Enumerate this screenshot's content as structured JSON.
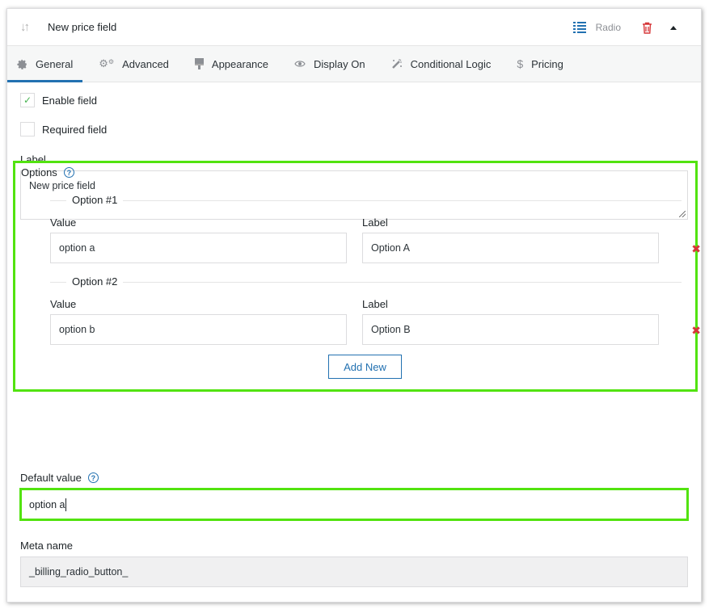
{
  "header": {
    "title": "New price field",
    "field_type": "Radio",
    "icons": {
      "sort": "sort-arrows-icon",
      "type": "list-icon",
      "delete": "trash-icon",
      "collapse": "caret-up-icon"
    }
  },
  "tabs": [
    {
      "label": "General",
      "icon": "gear-icon",
      "active": true
    },
    {
      "label": "Advanced",
      "icon": "gears-icon",
      "active": false
    },
    {
      "label": "Appearance",
      "icon": "paint-brush-icon",
      "active": false
    },
    {
      "label": "Display On",
      "icon": "eye-icon",
      "active": false
    },
    {
      "label": "Conditional Logic",
      "icon": "magic-wand-icon",
      "active": false
    },
    {
      "label": "Pricing",
      "icon": "dollar-icon",
      "active": false
    }
  ],
  "general": {
    "enable_field": {
      "label": "Enable field",
      "checked": true,
      "check_glyph": "✓"
    },
    "required_field": {
      "label": "Required field",
      "checked": false
    },
    "label_field": {
      "label": "Label",
      "value": "New price field"
    },
    "options": {
      "title": "Options",
      "help_glyph": "?",
      "items": [
        {
          "legend": "Option #1",
          "value_label": "Value",
          "value": "option a",
          "label_label": "Label",
          "label": "Option A"
        },
        {
          "legend": "Option #2",
          "value_label": "Value",
          "value": "option b",
          "label_label": "Label",
          "label": "Option B"
        }
      ],
      "remove_glyph": "✖",
      "add_new_label": "Add New"
    },
    "default_value": {
      "label": "Default value",
      "help_glyph": "?",
      "value": "option a"
    },
    "meta_name": {
      "label": "Meta name",
      "value": "_billing_radio_button_"
    }
  },
  "colors": {
    "accent": "#2271b1",
    "highlight": "#52e30f",
    "danger": "#d63638",
    "check": "#46b450"
  }
}
